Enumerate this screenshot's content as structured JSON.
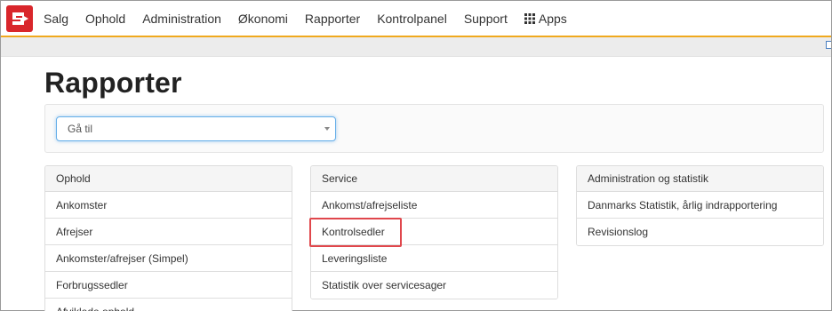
{
  "navbar": {
    "items": [
      {
        "label": "Salg"
      },
      {
        "label": "Ophold"
      },
      {
        "label": "Administration"
      },
      {
        "label": "Økonomi"
      },
      {
        "label": "Rapporter"
      },
      {
        "label": "Kontrolpanel"
      },
      {
        "label": "Support"
      },
      {
        "label": "Apps",
        "icon": "grid-icon"
      }
    ]
  },
  "page": {
    "title": "Rapporter"
  },
  "goto": {
    "placeholder": "Gå til"
  },
  "panels": [
    {
      "heading": "Ophold",
      "items": [
        "Ankomster",
        "Afrejser",
        "Ankomster/afrejser (Simpel)",
        "Forbrugssedler",
        "Afviklede ophold"
      ]
    },
    {
      "heading": "Service",
      "items": [
        "Ankomst/afrejseliste",
        "Kontrolsedler",
        "Leveringsliste",
        "Statistik over servicesager"
      ]
    },
    {
      "heading": "Administration og statistik",
      "items": [
        "Danmarks Statistik, årlig indrapportering",
        "Revisionslog"
      ]
    }
  ],
  "colors": {
    "accent_border": "#f0a91e",
    "logo_bg": "#d9262b",
    "highlight": "#e0474c",
    "focus": "#66afe9"
  }
}
